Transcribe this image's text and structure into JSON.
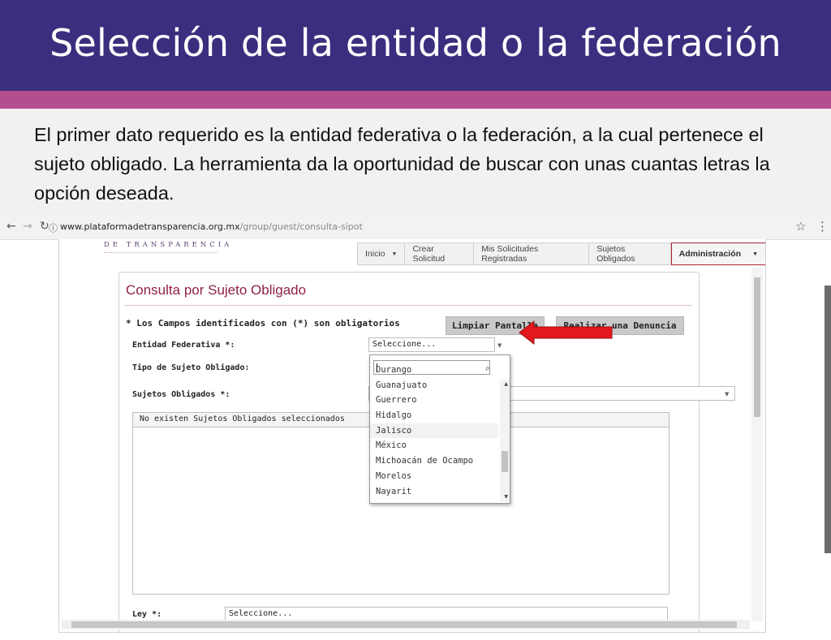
{
  "slide": {
    "title": "Selección de la entidad o la federación",
    "intro": "El primer dato requerido es la entidad federativa o la federación, a la cual pertenece el sujeto obligado. La herramienta da la oportunidad de buscar con unas cuantas letras la opción deseada.",
    "colors": {
      "title_band": "#3b2e7e",
      "accent_band": "#b24f8f"
    }
  },
  "browser": {
    "url_domain": "www.plataformadetransparencia.org.mx",
    "url_path": "/group/guest/consulta-sipot"
  },
  "site": {
    "logo_text": "DE TRANSPARENCIA",
    "menu": [
      {
        "label": "Inicio",
        "has_caret": true
      },
      {
        "label": "Crear Solicitud"
      },
      {
        "label": "Mis Solicitudes Registradas"
      },
      {
        "label": "Sujetos Obligados"
      },
      {
        "label": "Administración",
        "has_caret": true
      }
    ]
  },
  "form": {
    "title": "Consulta por Sujeto Obligado",
    "required_note": "* Los Campos identificados con (*) son obligatorios",
    "clear_button": "Limpiar Pantalla",
    "complaint_button": "Realizar una Denuncia",
    "entidad_label": "Entidad Federativa *:",
    "entidad_value": "Seleccione...",
    "tipo_label": "Tipo de Sujeto Obligado:",
    "sujetos_label": "Sujetos Obligados *:",
    "list_header": "No existen Sujetos Obligados seleccionados",
    "ley_label": "Ley *:",
    "ley_value": "Seleccione..."
  },
  "dropdown": {
    "search_value": "",
    "items": [
      "Durango",
      "Guanajuato",
      "Guerrero",
      "Hidalgo",
      "Jalisco",
      "México",
      "Michoacán de Ocampo",
      "Morelos",
      "Nayarit"
    ],
    "highlighted": "Jalisco"
  }
}
